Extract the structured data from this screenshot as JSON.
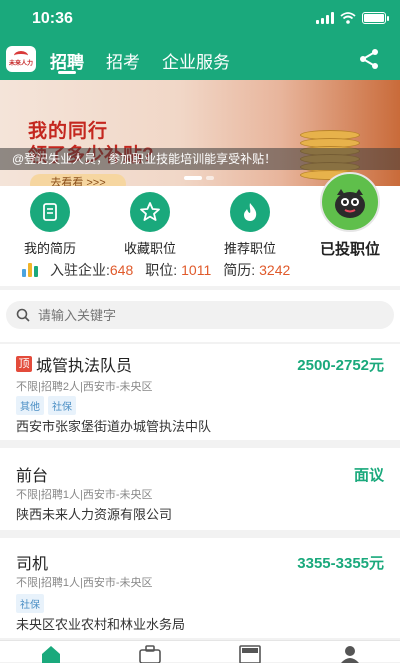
{
  "status": {
    "time": "10:36"
  },
  "header": {
    "logo_text": "未来人力",
    "tabs": [
      {
        "label": "招聘",
        "active": true
      },
      {
        "label": "招考",
        "active": false
      },
      {
        "label": "企业服务",
        "active": false
      }
    ],
    "accent": "#1aa97c"
  },
  "banner": {
    "title": "我的同行",
    "subtitle": "领了多少补贴?",
    "caption": "@登记失业人员，参加职业技能培训能享受补贴！",
    "button": "去看看 >>>"
  },
  "quick_links": [
    {
      "label": "我的简历",
      "icon": "resume-icon"
    },
    {
      "label": "收藏职位",
      "icon": "star-icon"
    },
    {
      "label": "推荐职位",
      "icon": "flame-icon"
    },
    {
      "label": "已投职位",
      "icon": "avatar-icon"
    }
  ],
  "stats": {
    "companies_label": "入驻企业:",
    "companies_value": "648",
    "jobs_label": "职位:",
    "jobs_value": "1011",
    "resumes_label": "简历:",
    "resumes_value": "3242"
  },
  "search": {
    "placeholder": "请输入关键字"
  },
  "jobs": [
    {
      "title": "城管执法队员",
      "top_badge": "顶",
      "salary": "2500-2752元",
      "meta": "不限|招聘2人|西安市-未央区",
      "tags": [
        "其他",
        "社保"
      ],
      "company": "西安市张家堡街道办城管执法中队"
    },
    {
      "title": "前台",
      "salary": "面议",
      "meta": "不限|招聘1人|西安市-未央区",
      "tags": [],
      "company": "陕西未来人力资源有限公司"
    },
    {
      "title": "司机",
      "salary": "3355-3355元",
      "meta": "不限|招聘1人|西安市-未央区",
      "tags": [
        "社保"
      ],
      "company": "未央区农业农村和林业水务局"
    }
  ],
  "bottom_nav": [
    {
      "icon": "home-icon"
    },
    {
      "icon": "briefcase-icon"
    },
    {
      "icon": "news-icon"
    },
    {
      "icon": "profile-icon"
    }
  ]
}
